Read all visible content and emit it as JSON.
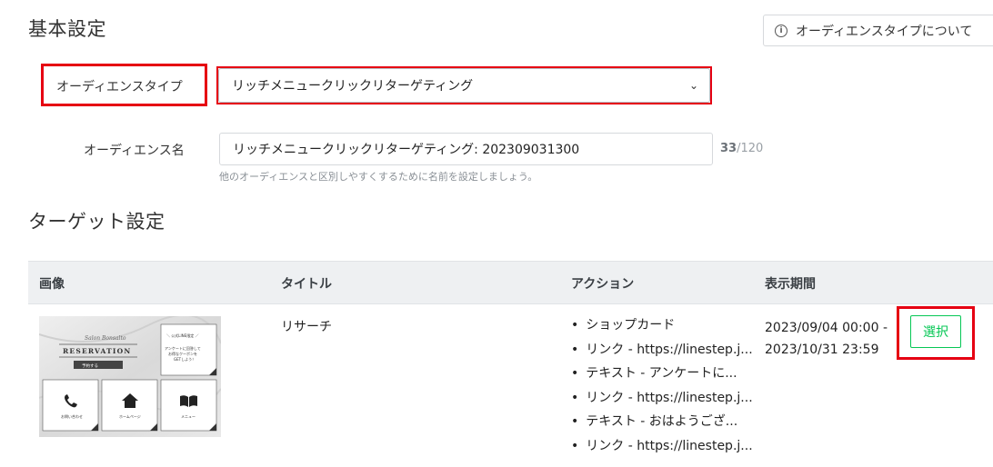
{
  "basic_settings": {
    "heading": "基本設定",
    "info_button_label": "オーディエンスタイプについて",
    "audience_type_label": "オーディエンスタイプ",
    "audience_type_value": "リッチメニュークリックリターゲティング",
    "audience_name_label": "オーディエンス名",
    "audience_name_value": "リッチメニュークリックリターゲティング: 202309031300",
    "char_count": "33",
    "char_limit": "/120",
    "name_hint": "他のオーディエンスと区別しやすくするために名前を設定しましょう。"
  },
  "target_settings": {
    "heading": "ターゲット設定",
    "columns": [
      "画像",
      "タイトル",
      "アクション",
      "表示期間"
    ],
    "rows": [
      {
        "thumbnail": {
          "script_title": "Salon Bonsalto",
          "reservation": "RESERVATION",
          "reserve_button": "予約する",
          "promo_line1": "＼ 公式LINE限定 ／",
          "promo_line2": "アンケートに回答して",
          "promo_line3": "お得なクーポンを",
          "promo_line4": "GETしよう！",
          "tile1": "お問い合わせ",
          "tile2": "ホームページ",
          "tile3": "メニュー"
        },
        "title": "リサーチ",
        "actions": [
          "ショップカード",
          "リンク - https://linestep.j...",
          "テキスト - アンケートに...",
          "リンク - https://linestep.j...",
          "テキスト - おはようござ...",
          "リンク - https://linestep.j..."
        ],
        "period_start": "2023/09/04 00:00 -",
        "period_end": "2023/10/31 23:59",
        "select_label": "選択"
      }
    ]
  },
  "colors": {
    "highlight_red": "#e60012",
    "line_green": "#06c755",
    "header_gray": "#eef0f2"
  }
}
